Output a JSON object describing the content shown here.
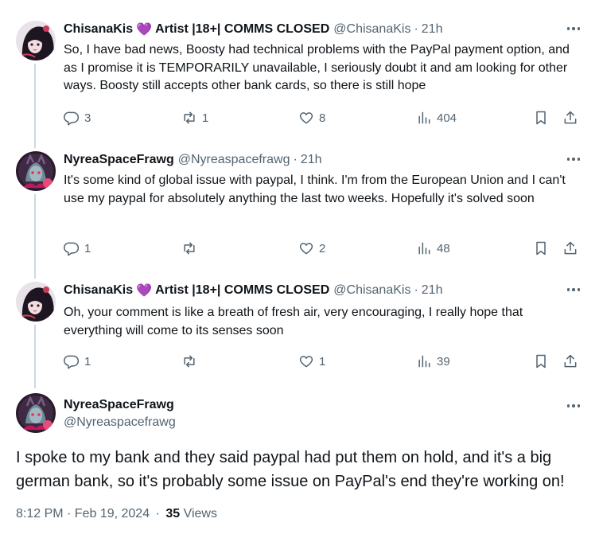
{
  "tweets": [
    {
      "display_name": "ChisanaKis",
      "name_badge": "💜",
      "name_suffix": "Artist |18+| COMMS CLOSED",
      "handle": "@ChisanaKis",
      "time": "21h",
      "text": "So, I have bad news, Boosty had technical problems with the PayPal payment option, and as I promise it is TEMPORARILY unavailable, I seriously doubt it and am looking for other ways. Boosty still accepts other bank cards, so there is still hope",
      "replies": "3",
      "reposts": "1",
      "likes": "8",
      "views": "404"
    },
    {
      "display_name": "NyreaSpaceFrawg",
      "handle": "@Nyreaspacefrawg",
      "time": "21h",
      "text": "It's some kind of global issue with paypal, I think. I'm from the European Union and I can't use my paypal for absolutely anything the last two weeks. Hopefully it's solved soon",
      "replies": "1",
      "reposts": "",
      "likes": "2",
      "views": "48"
    },
    {
      "display_name": "ChisanaKis",
      "name_badge": "💜",
      "name_suffix": "Artist |18+| COMMS CLOSED",
      "handle": "@ChisanaKis",
      "time": "21h",
      "text": "Oh, your comment is like a breath of fresh air, very encouraging, I really hope that everything will come to its senses soon",
      "replies": "1",
      "reposts": "",
      "likes": "1",
      "views": "39"
    }
  ],
  "main": {
    "display_name": "NyreaSpaceFrawg",
    "handle": "@Nyreaspacefrawg",
    "text": "I spoke to my bank and they said paypal had put them on hold, and it's a big german bank, so it's probably some issue on PayPal's end they're working on!",
    "timestamp": "8:12 PM · Feb 19, 2024",
    "separator": "·",
    "views_count": "35",
    "views_label": "Views"
  },
  "icons": {
    "reply": "reply-icon",
    "repost": "repost-icon",
    "like": "heart-icon",
    "views": "views-chart-icon",
    "bookmark": "bookmark-icon",
    "share": "share-icon",
    "more": "more-icon"
  },
  "colors": {
    "text": "#0f1419",
    "muted": "#536471",
    "thread_line": "#cfd9de"
  }
}
